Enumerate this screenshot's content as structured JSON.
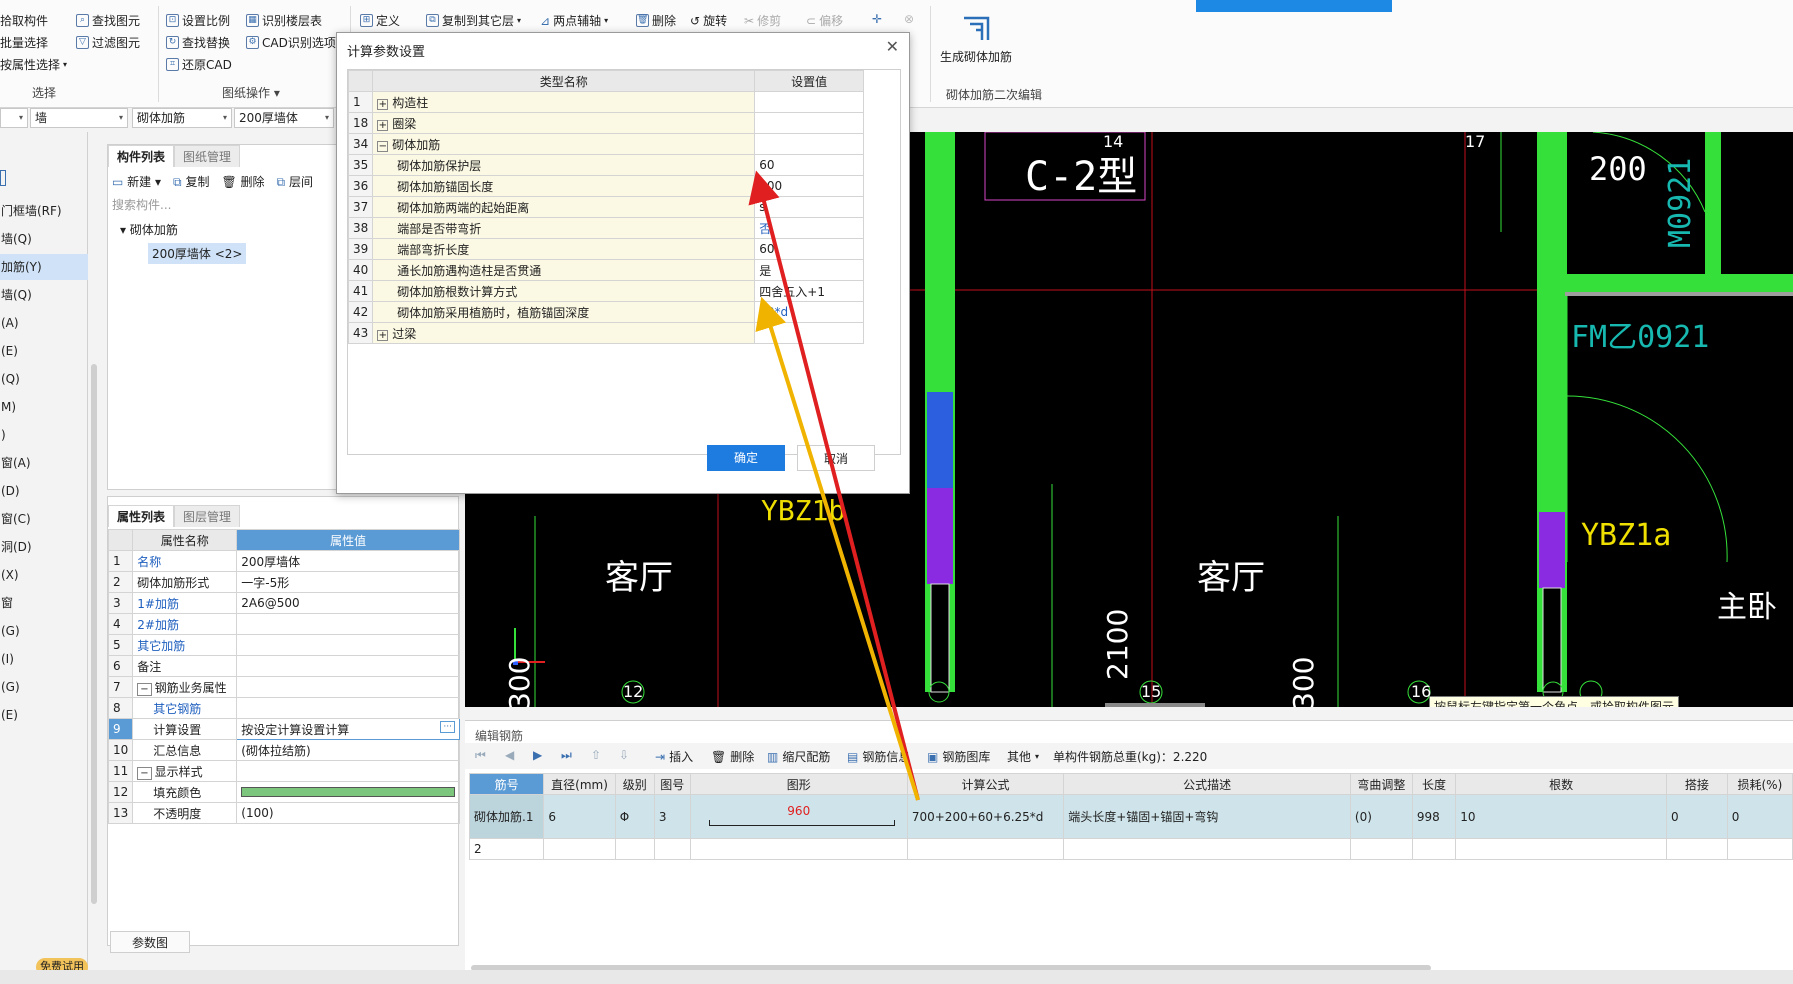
{
  "ribbon": {
    "col1": [
      "拾取构件",
      "批量选择",
      "按属性选择"
    ],
    "col2": [
      "查找图元",
      "过滤图元"
    ],
    "col3": [
      "设置比例",
      "查找替换",
      "还原CAD"
    ],
    "col4": [
      "识别楼层表",
      "CAD识别选项"
    ],
    "group_select": "选择",
    "group_drawing": "图纸操作",
    "edit_tools": [
      "定义",
      "复制到其它层",
      "两点辅轴",
      "删除",
      "旋转",
      "修剪",
      "偏移"
    ],
    "generate_btn": "生成砌体加筋",
    "group_secondary": "砌体加筋二次编辑"
  },
  "combos": [
    "墙",
    "砌体加筋",
    "200厚墙体"
  ],
  "left_nav": [
    {
      "label": "门框墙(RF)"
    },
    {
      "label": "墙(Q)"
    },
    {
      "label": "加筋(Y)",
      "selected": true
    },
    {
      "label": "墙(Q)"
    },
    {
      "label": "(A)"
    },
    {
      "label": "(E)"
    },
    {
      "label": "(Q)"
    },
    {
      "label": "M)"
    },
    {
      "label": ")"
    },
    {
      "label": "窗(A)"
    },
    {
      "label": "(D)"
    },
    {
      "label": "窗(C)"
    },
    {
      "label": "洞(D)"
    },
    {
      "label": "(X)"
    },
    {
      "label": "窗"
    },
    {
      "label": "(G)"
    },
    {
      "label": "(I)"
    },
    {
      "label": "(G)"
    },
    {
      "label": "(E)"
    }
  ],
  "free_trial": "免费试用",
  "component_panel": {
    "tabs": [
      "构件列表",
      "图纸管理"
    ],
    "new": "新建",
    "copy": "复制",
    "delete": "删除",
    "floor": "层间",
    "search_placeholder": "搜索构件...",
    "tree_root": "砌体加筋",
    "tree_child": "200厚墙体 <2>"
  },
  "property_panel": {
    "tabs": [
      "属性列表",
      "图层管理"
    ],
    "headers": [
      "属性名称",
      "属性值"
    ],
    "rows": [
      {
        "n": "1",
        "name": "名称",
        "value": "200厚墙体",
        "blue": true
      },
      {
        "n": "2",
        "name": "砌体加筋形式",
        "value": "一字-5形"
      },
      {
        "n": "3",
        "name": "1#加筋",
        "value": "2A6@500",
        "blue": true
      },
      {
        "n": "4",
        "name": "2#加筋",
        "value": "",
        "blue": true
      },
      {
        "n": "5",
        "name": "其它加筋",
        "value": "",
        "blue": true
      },
      {
        "n": "6",
        "name": "备注",
        "value": ""
      },
      {
        "n": "7",
        "name": "钢筋业务属性",
        "value": "",
        "group": true
      },
      {
        "n": "8",
        "name": "其它钢筋",
        "value": "",
        "blue": true,
        "indent": true
      },
      {
        "n": "9",
        "name": "计算设置",
        "value": "按设定计算设置计算",
        "indent": true,
        "selected": true
      },
      {
        "n": "10",
        "name": "汇总信息",
        "value": "(砌体拉结筋)",
        "indent": true
      },
      {
        "n": "11",
        "name": "显示样式",
        "value": "",
        "group": true
      },
      {
        "n": "12",
        "name": "填充颜色",
        "value": "",
        "indent": true,
        "color": "#7dc67d"
      },
      {
        "n": "13",
        "name": "不透明度",
        "value": "(100)",
        "indent": true
      }
    ],
    "param_btn": "参数图"
  },
  "dialog": {
    "title": "计算参数设置",
    "headers": [
      "类型名称",
      "设置值"
    ],
    "rows": [
      {
        "n": "1",
        "name": "构造柱",
        "value": "",
        "group": "+"
      },
      {
        "n": "18",
        "name": "圈梁",
        "value": "",
        "group": "+"
      },
      {
        "n": "34",
        "name": "砌体加筋",
        "value": "",
        "group": "-"
      },
      {
        "n": "35",
        "name": "砌体加筋保护层",
        "value": "60"
      },
      {
        "n": "36",
        "name": "砌体加筋锚固长度",
        "value": "200"
      },
      {
        "n": "37",
        "name": "砌体加筋两端的起始距离",
        "value": "s"
      },
      {
        "n": "38",
        "name": "端部是否带弯折",
        "value": "否",
        "blue": true
      },
      {
        "n": "39",
        "name": "端部弯折长度",
        "value": "60"
      },
      {
        "n": "40",
        "name": "通长加筋遇构造柱是否贯通",
        "value": "是"
      },
      {
        "n": "41",
        "name": "砌体加筋根数计算方式",
        "value": "四舍五入+1"
      },
      {
        "n": "42",
        "name": "砌体加筋采用植筋时，植筋锚固深度",
        "value": "10*d",
        "blue": true
      },
      {
        "n": "43",
        "name": "过梁",
        "value": "",
        "group": "+"
      }
    ],
    "ok": "确定",
    "cancel": "取消"
  },
  "cad": {
    "labels": [
      "C-2型",
      "YBZ1b",
      "客厅",
      "客厅",
      "YBZ1a",
      "主卧",
      "200",
      "M0921",
      "FM乙0921",
      "2100",
      "300",
      "300"
    ],
    "axis": [
      "14",
      "17",
      "12",
      "15",
      "16"
    ],
    "tooltip": "按鼠标左键指定第一个角点，或拾取构件图元"
  },
  "editor": {
    "title": "编辑钢筋",
    "tools": [
      "插入",
      "删除",
      "缩尺配筋",
      "钢筋信息",
      "钢筋图库",
      "其他"
    ],
    "total": "单构件钢筋总重(kg)：2.220",
    "headers": [
      "筋号",
      "直径(mm)",
      "级别",
      "图号",
      "图形",
      "计算公式",
      "公式描述",
      "弯曲调整",
      "长度",
      "根数",
      "搭接",
      "损耗(%)"
    ],
    "row": {
      "n": "1",
      "name": "砌体加筋.1",
      "dia": "6",
      "grade": "Φ",
      "fig": "3",
      "shape": "960",
      "formula": "700+200+60+6.25*d",
      "desc": "端头长度+锚固+锚固+弯钩",
      "bend": "(0)",
      "len": "998",
      "count": "10",
      "lap": "0",
      "loss": "0"
    },
    "row2": "2"
  }
}
